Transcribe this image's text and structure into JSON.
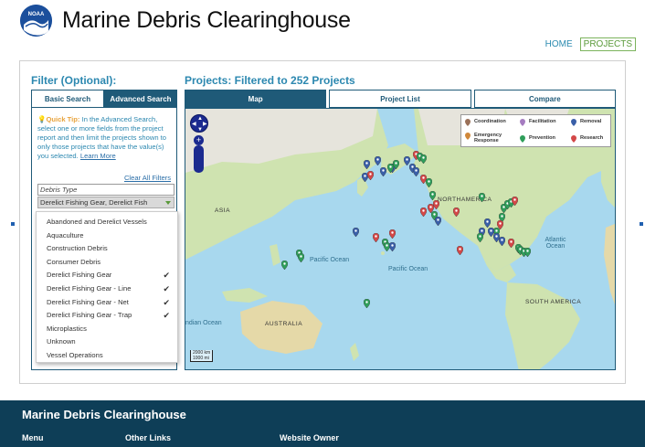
{
  "header": {
    "logo_text": "NOAA",
    "title": "Marine Debris Clearinghouse",
    "nav": [
      {
        "label": "HOME",
        "active": false
      },
      {
        "label": "PROJECTS",
        "active": true
      }
    ]
  },
  "filter": {
    "heading": "Filter (Optional):",
    "tabs": [
      {
        "label": "Basic Search",
        "active": false
      },
      {
        "label": "Advanced Search",
        "active": true
      }
    ],
    "quick_tip_label": "Quick Tip:",
    "quick_tip_text": "In the Advanced Search, select one or more fields from the project report and then limit the projects shown to only those projects that have the value(s) you selected.",
    "learn_more": "Learn More",
    "clear_all": "Clear All Filters",
    "field_label": "Debris Type",
    "selected_value": "Derelict Fishing Gear, Derelict Fish",
    "options": [
      {
        "label": "Abandoned and Derelict Vessels",
        "checked": false
      },
      {
        "label": "Aquaculture",
        "checked": false
      },
      {
        "label": "Construction Debris",
        "checked": false
      },
      {
        "label": "Consumer Debris",
        "checked": false
      },
      {
        "label": "Derelict Fishing Gear",
        "checked": true
      },
      {
        "label": "Derelict Fishing Gear - Line",
        "checked": true
      },
      {
        "label": "Derelict Fishing Gear - Net",
        "checked": true
      },
      {
        "label": "Derelict Fishing Gear - Trap",
        "checked": true
      },
      {
        "label": "Microplastics",
        "checked": false
      },
      {
        "label": "Unknown",
        "checked": false
      },
      {
        "label": "Vessel Operations",
        "checked": false
      }
    ],
    "check_glyph": "✔"
  },
  "projects": {
    "heading": "Projects:  Filtered to 252 Projects",
    "tabs": [
      {
        "label": "Map",
        "active": true
      },
      {
        "label": "Project List",
        "active": false
      },
      {
        "label": "Compare",
        "active": false
      }
    ]
  },
  "map": {
    "labels": {
      "asia": "ASIA",
      "north_america": "NORTHAMERICA",
      "australia": "AUSTRALIA",
      "south_america": "SOUTH AMERICA",
      "pacific_1": "Pacific Ocean",
      "pacific_2": "Pacific Ocean",
      "atlantic": "Atlantic\nOcean",
      "indian": "ndian Ocean"
    },
    "legend": [
      {
        "label": "Coordination",
        "color": "#9a7058"
      },
      {
        "label": "Facilitation",
        "color": "#a57cc0"
      },
      {
        "label": "Removal",
        "color": "#3a5fa8"
      },
      {
        "label": "Emergency\nResponse",
        "color": "#d0883a"
      },
      {
        "label": "Prevention",
        "color": "#2f9e5a"
      },
      {
        "label": "Research",
        "color": "#d34848"
      }
    ],
    "scale": [
      "2000 km",
      "1000 mi"
    ],
    "colors": {
      "ocean": "#a8d8ee",
      "land": "#cfe3b0",
      "land_north": "#e6e4dc",
      "desert": "#e5d9a8"
    }
  },
  "footer": {
    "title": "Marine Debris Clearinghouse",
    "columns": [
      "Menu",
      "Other Links",
      "Website Owner"
    ]
  }
}
